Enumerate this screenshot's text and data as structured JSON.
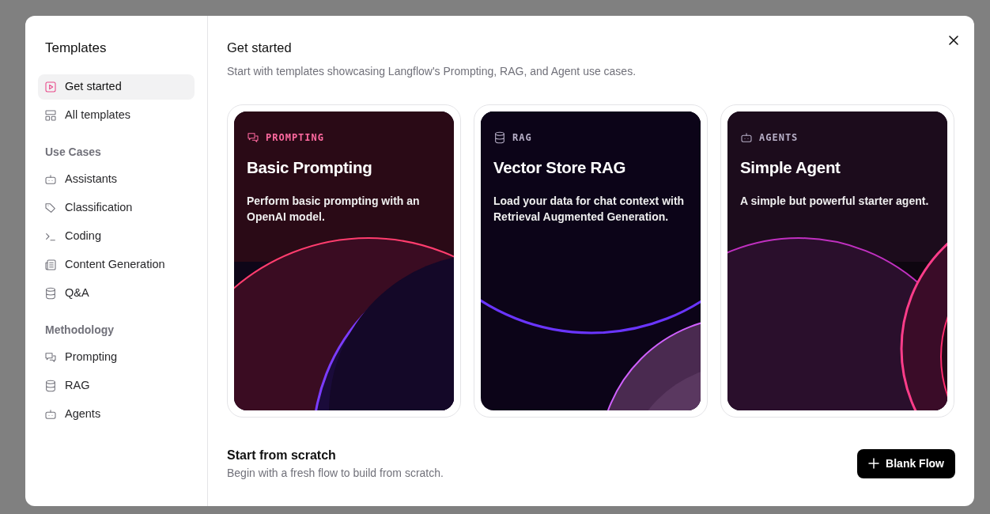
{
  "sidebar": {
    "title": "Templates",
    "top_items": [
      {
        "label": "Get started",
        "selected": true
      },
      {
        "label": "All templates",
        "selected": false
      }
    ],
    "sections": [
      {
        "heading": "Use Cases",
        "items": [
          {
            "label": "Assistants",
            "selected": false
          },
          {
            "label": "Classification",
            "selected": false
          },
          {
            "label": "Coding",
            "selected": false
          },
          {
            "label": "Content Generation",
            "selected": false
          },
          {
            "label": "Q&A",
            "selected": false
          }
        ]
      },
      {
        "heading": "Methodology",
        "items": [
          {
            "label": "Prompting",
            "selected": false
          },
          {
            "label": "RAG",
            "selected": false
          },
          {
            "label": "Agents",
            "selected": false
          }
        ]
      }
    ]
  },
  "main": {
    "title": "Get started",
    "subtitle": "Start with templates showcasing Langflow's Prompting, RAG, and Agent use cases.",
    "cards": [
      {
        "tag": "PROMPTING",
        "title": "Basic Prompting",
        "description": "Perform basic prompting with an OpenAI model."
      },
      {
        "tag": "RAG",
        "title": "Vector Store RAG",
        "description": "Load your data for chat context with Retrieval Augmented Generation."
      },
      {
        "tag": "AGENTS",
        "title": "Simple Agent",
        "description": "A simple but powerful starter agent."
      }
    ],
    "scratch": {
      "title": "Start from scratch",
      "subtitle": "Begin with a fresh flow to build from scratch.",
      "button": "Blank Flow"
    }
  }
}
